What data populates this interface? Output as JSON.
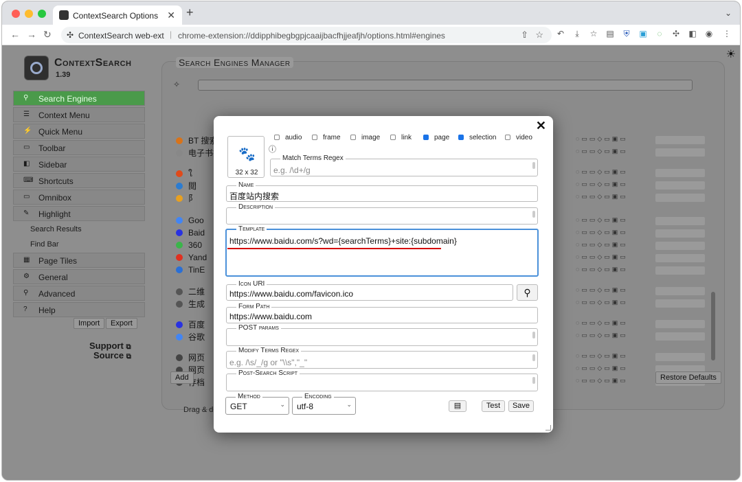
{
  "browser": {
    "tab_title": "ContextSearch Options",
    "tab_close": "✕",
    "new_tab": "+",
    "site_name": "ContextSearch web-ext",
    "url": "chrome-extension://ddipphibegbgpjcaaijbacfhjjeafjh/options.html#engines"
  },
  "app": {
    "brand": "ContextSearch",
    "version": "1.39",
    "theme_icon": "☀"
  },
  "sidebar": {
    "items": [
      {
        "label": "Search Engines",
        "icon": "search-icon",
        "glyph": "⚲",
        "active": true
      },
      {
        "label": "Context Menu",
        "icon": "menu-icon",
        "glyph": "☰"
      },
      {
        "label": "Quick Menu",
        "icon": "lightning-icon",
        "glyph": "⚡"
      },
      {
        "label": "Toolbar",
        "icon": "toolbar-icon",
        "glyph": "▭"
      },
      {
        "label": "Sidebar",
        "icon": "sidebar-icon",
        "glyph": "◧"
      },
      {
        "label": "Shortcuts",
        "icon": "keyboard-icon",
        "glyph": "⌨"
      },
      {
        "label": "Omnibox",
        "icon": "omnibox-icon",
        "glyph": "▭"
      },
      {
        "label": "Highlight",
        "icon": "highlighter-icon",
        "glyph": "✎"
      }
    ],
    "subitems": [
      "Search Results",
      "Find Bar"
    ],
    "items2": [
      {
        "label": "Page Tiles",
        "icon": "tiles-icon",
        "glyph": "▦"
      },
      {
        "label": "General",
        "icon": "gear-icon",
        "glyph": "⚙"
      },
      {
        "label": "Advanced",
        "icon": "advanced-icon",
        "glyph": "⚲"
      },
      {
        "label": "Help",
        "icon": "help-icon",
        "glyph": "?"
      }
    ],
    "import_label": "Import",
    "export_label": "Export",
    "support_label": "Support",
    "source_label": "Source"
  },
  "manager": {
    "title": "Search Engines Manager",
    "rows": [
      {
        "name": "BT 搜索",
        "color": "#d8731a"
      },
      {
        "name": "电子书搜索",
        "color": "#888888"
      },
      {
        "name": "ใ",
        "color": "#e04a1a"
      },
      {
        "name": "閲",
        "color": "#2c7cd1"
      },
      {
        "name": "阝",
        "color": "#e8a020"
      },
      {
        "name": "Goo",
        "color": "#4285f4"
      },
      {
        "name": "Baid",
        "color": "#2932e1"
      },
      {
        "name": "360",
        "color": "#3bb54a"
      },
      {
        "name": "Yand",
        "color": "#e03020"
      },
      {
        "name": "TinE",
        "color": "#2a6fd6"
      },
      {
        "name": "二维",
        "color": "#555555"
      },
      {
        "name": "生成",
        "color": "#555555"
      },
      {
        "name": "百度",
        "color": "#2932e1"
      },
      {
        "name": "谷歌",
        "color": "#4285f4"
      },
      {
        "name": "网页",
        "color": "#444444"
      },
      {
        "name": "网页",
        "color": "#444444"
      },
      {
        "name": "存档",
        "color": "#444444"
      }
    ],
    "add_label": "Add",
    "restore_label": "Restore Defaults",
    "drag_text": "Drag & d"
  },
  "modal": {
    "icon_size": "32 x 32",
    "contexts": [
      {
        "label": "audio",
        "checked": false
      },
      {
        "label": "frame",
        "checked": false
      },
      {
        "label": "image",
        "checked": false
      },
      {
        "label": "link",
        "checked": false
      },
      {
        "label": "page",
        "checked": true
      },
      {
        "label": "selection",
        "checked": true
      },
      {
        "label": "video",
        "checked": false
      }
    ],
    "info_icon": "ⓘ",
    "match_label": "Match Terms Regex",
    "match_placeholder": "e.g. /\\d+/g",
    "name_label": "Name",
    "name_value": "百度站内搜索",
    "description_label": "Description",
    "template_label": "Template",
    "template_value": "https://www.baidu.com/s?wd={searchTerms}+site:{subdomain}",
    "icon_uri_label": "Icon URI",
    "icon_uri_value": "https://www.baidu.com/favicon.ico",
    "form_path_label": "Form Path",
    "form_path_value": "https://www.baidu.com",
    "post_label": "POST params",
    "modify_label": "Modify Terms Regex",
    "modify_placeholder": "e.g. /\\s/_/g or \"\\\\s\",\"_\"",
    "post_script_label": "Post-Search Script",
    "method_label": "Method",
    "method_value": "GET",
    "encoding_label": "Encoding",
    "encoding_value": "utf-8",
    "test_label": "Test",
    "save_label": "Save",
    "close_icon": "✕"
  }
}
